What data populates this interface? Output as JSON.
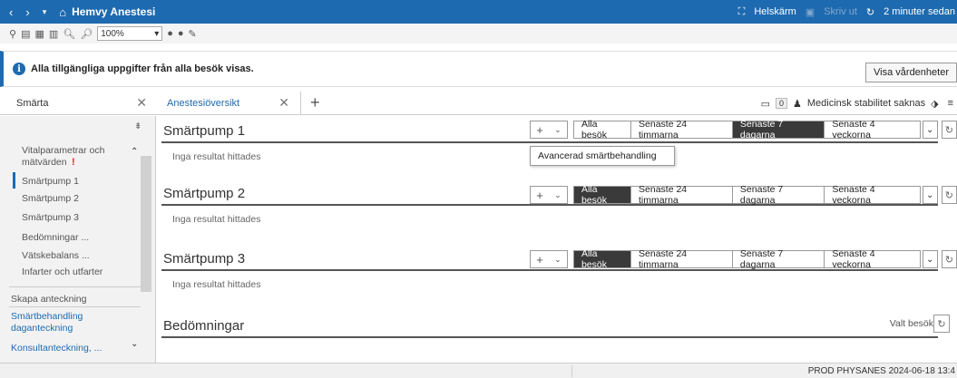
{
  "titlebar": {
    "title": "Hemvy Anestesi",
    "fullscreen": "Helskärm",
    "menu": "Skriv ut",
    "refreshed": "2 minuter sedan"
  },
  "toolbar": {
    "zoom": "100%"
  },
  "info": {
    "message": "Alla tillgängliga uppgifter från alla besök visas.",
    "button": "Visa vårdenheter"
  },
  "left_tab": {
    "label": "Smärta"
  },
  "main_tab": {
    "label": "Anestesiöversikt",
    "warning": "Medicinsk stabilitet saknas",
    "badge_count": "0"
  },
  "sidebar": {
    "items": [
      "Vitalparametrar och mätvärden",
      "Smärtpump 1",
      "Smärtpump 2",
      "Smärtpump 3",
      "Bedömningar ...",
      "Vätskebalans ...",
      "Infarter och utfarter"
    ],
    "create_note": "Skapa anteckning",
    "links": [
      "Smärtbehandling daganteckning",
      "Konsultanteckning, ..."
    ]
  },
  "sections": [
    {
      "title": "Smärtpump 1",
      "empty": "Inga resultat hittades",
      "selected": "Senaste 7 dagarna"
    },
    {
      "title": "Smärtpump 2",
      "empty": "Inga resultat hittades",
      "selected": "Alla besök"
    },
    {
      "title": "Smärtpump 3",
      "empty": "Inga resultat hittades",
      "selected": "Alla besök"
    },
    {
      "title": "Bedömningar",
      "filter": "Valt besök"
    }
  ],
  "filters": [
    "Alla besök",
    "Senaste 24 timmarna",
    "Senaste 7 dagarna",
    "Senaste 4 veckorna"
  ],
  "popup": {
    "label": "Avancerad smärtbehandling"
  },
  "status": {
    "text": "PROD  PHYSANES  2024-06-18  13:4"
  }
}
